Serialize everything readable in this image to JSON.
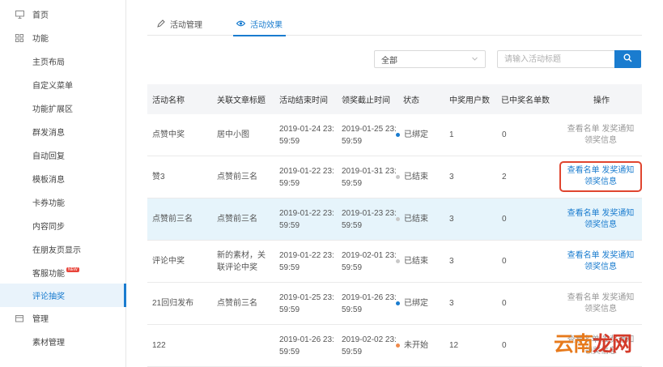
{
  "sidebar": {
    "items": [
      {
        "label": "首页",
        "type": "section",
        "icon": "monitor-icon"
      },
      {
        "label": "功能",
        "type": "section",
        "icon": "grid-icon"
      },
      {
        "label": "主页布局",
        "type": "sub"
      },
      {
        "label": "自定义菜单",
        "type": "sub"
      },
      {
        "label": "功能扩展区",
        "type": "sub"
      },
      {
        "label": "群发消息",
        "type": "sub"
      },
      {
        "label": "自动回复",
        "type": "sub"
      },
      {
        "label": "模板消息",
        "type": "sub"
      },
      {
        "label": "卡券功能",
        "type": "sub"
      },
      {
        "label": "内容同步",
        "type": "sub"
      },
      {
        "label": "在朋友页显示",
        "type": "sub"
      },
      {
        "label": "客服功能",
        "type": "sub",
        "badge": "NEW"
      },
      {
        "label": "评论抽奖",
        "type": "sub",
        "active": true
      },
      {
        "label": "管理",
        "type": "section",
        "icon": "folder-icon"
      },
      {
        "label": "素材管理",
        "type": "sub"
      }
    ]
  },
  "tabs": [
    {
      "label": "活动管理",
      "icon": "pencil-icon",
      "active": false
    },
    {
      "label": "活动效果",
      "icon": "eye-icon",
      "active": true
    }
  ],
  "filter": {
    "select_value": "全部",
    "search_placeholder": "请输入活动标题"
  },
  "table": {
    "columns": [
      "活动名称",
      "关联文章标题",
      "活动结束时间",
      "领奖截止时间",
      "状态",
      "中奖用户数",
      "已中奖名单数",
      "操作"
    ],
    "rows": [
      {
        "name": "点赞中奖",
        "article": "居中小图",
        "end_time": "2019-01-24 23:59:59",
        "deadline": "2019-01-25 23:59:59",
        "status": "已绑定",
        "status_color": "#1a7ccf",
        "winners": "1",
        "listed": "0",
        "ops_style": "grey",
        "highlight": false,
        "boxed": false
      },
      {
        "name": "赞3",
        "article": "点赞前三名",
        "end_time": "2019-01-22 23:59:59",
        "deadline": "2019-01-31 23:59:59",
        "status": "已结束",
        "status_color": "#c8c8c8",
        "winners": "3",
        "listed": "2",
        "ops_style": "blue",
        "highlight": false,
        "boxed": true
      },
      {
        "name": "点赞前三名",
        "article": "点赞前三名",
        "end_time": "2019-01-22 23:59:59",
        "deadline": "2019-01-23 23:59:59",
        "status": "已结束",
        "status_color": "#c8c8c8",
        "winners": "3",
        "listed": "0",
        "ops_style": "blue",
        "highlight": true,
        "boxed": false
      },
      {
        "name": "评论中奖",
        "article": "新的素材，关联评论中奖",
        "end_time": "2019-01-22 23:59:59",
        "deadline": "2019-02-01 23:59:59",
        "status": "已结束",
        "status_color": "#c8c8c8",
        "winners": "3",
        "listed": "0",
        "ops_style": "blue",
        "highlight": false,
        "boxed": false
      },
      {
        "name": "21回归发布",
        "article": "点赞前三名",
        "end_time": "2019-01-25 23:59:59",
        "deadline": "2019-01-26 23:59:59",
        "status": "已绑定",
        "status_color": "#1a7ccf",
        "winners": "3",
        "listed": "0",
        "ops_style": "grey",
        "highlight": false,
        "boxed": false
      },
      {
        "name": "122",
        "article": "",
        "end_time": "2019-01-26 23:59:59",
        "deadline": "2019-02-02 23:59:59",
        "status": "未开始",
        "status_color": "#f08a4b",
        "winners": "12",
        "listed": "0",
        "ops_style": "grey",
        "highlight": false,
        "boxed": false
      }
    ],
    "ops": {
      "view_list": "查看名单",
      "notify": "发奖通知",
      "claim_info": "领奖信息"
    }
  },
  "watermark": {
    "text_a": "云南",
    "text_b": "龙网"
  },
  "colors": {
    "accent": "#1a7ccf",
    "highlight_box": "#e0452f",
    "row_highlight": "#e6f4fb"
  }
}
